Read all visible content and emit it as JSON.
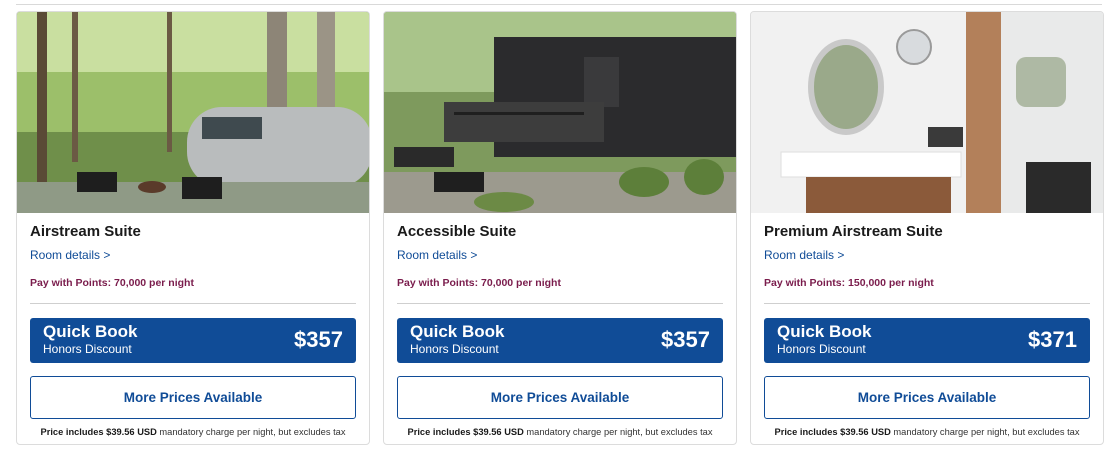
{
  "rooms": [
    {
      "name": "Airstream Suite",
      "details_link": "Room details >",
      "points": "Pay with Points: 70,000 per night",
      "quick_book": {
        "title": "Quick Book",
        "subtitle": "Honors Discount",
        "price": "$357"
      },
      "more_prices": "More Prices Available",
      "disclaimer": {
        "prefix": "Price includes",
        "amount": "$39.56 USD",
        "suffix": "mandatory charge per night, but excludes tax"
      }
    },
    {
      "name": "Accessible Suite",
      "details_link": "Room details >",
      "points": "Pay with Points: 70,000 per night",
      "quick_book": {
        "title": "Quick Book",
        "subtitle": "Honors Discount",
        "price": "$357"
      },
      "more_prices": "More Prices Available",
      "disclaimer": {
        "prefix": "Price includes",
        "amount": "$39.56 USD",
        "suffix": "mandatory charge per night, but excludes tax"
      }
    },
    {
      "name": "Premium Airstream Suite",
      "details_link": "Room details >",
      "points": "Pay with Points: 150,000 per night",
      "quick_book": {
        "title": "Quick Book",
        "subtitle": "Honors Discount",
        "price": "$371"
      },
      "more_prices": "More Prices Available",
      "disclaimer": {
        "prefix": "Price includes",
        "amount": "$39.56 USD",
        "suffix": "mandatory charge per night, but excludes tax"
      }
    }
  ],
  "colors": {
    "brand_blue": "#104c97",
    "points_text": "#7a1c4c"
  }
}
